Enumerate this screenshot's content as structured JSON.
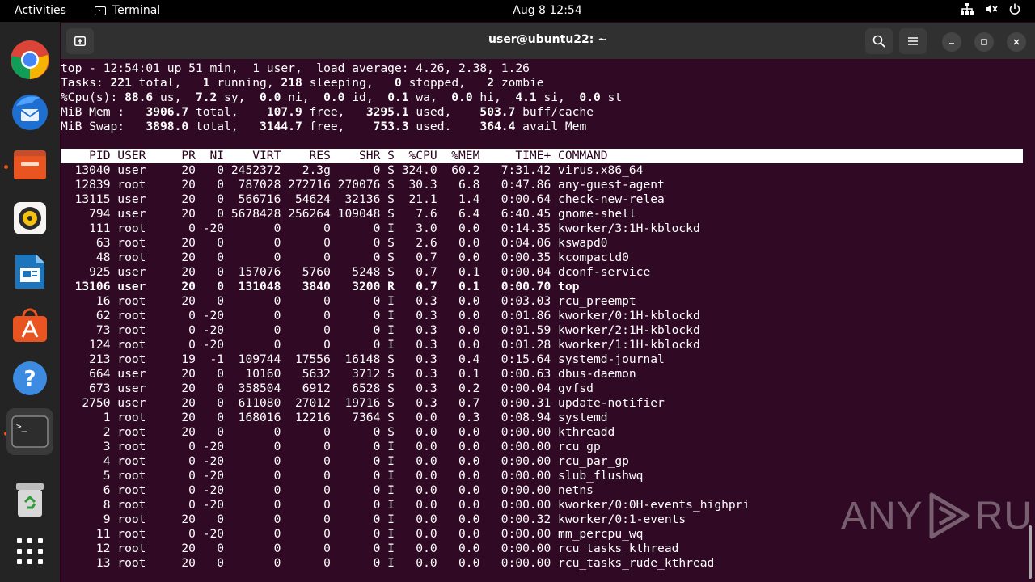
{
  "topbar": {
    "activities": "Activities",
    "app_name": "Terminal",
    "clock": "Aug 8  12:54"
  },
  "dock": {
    "items": [
      "Google Chrome",
      "Thunderbird Mail",
      "Files",
      "Rhythmbox",
      "LibreOffice Writer",
      "Ubuntu Software",
      "Help",
      "Terminal",
      "Trash",
      "Show Applications"
    ]
  },
  "window": {
    "title": "user@ubuntu22: ~"
  },
  "top": {
    "summary": {
      "line1": "top - 12:54:01 up 51 min,  1 user,  load average: 4.26, 2.38, 1.26",
      "tasks": [
        "Tasks: ",
        "221",
        " total,   ",
        "1",
        " running, ",
        "218",
        " sleeping,   ",
        "0",
        " stopped,   ",
        "2",
        " zombie"
      ],
      "cpu": [
        "%Cpu(s): ",
        "88.6",
        " us,  ",
        "7.2",
        " sy,  ",
        "0.0",
        " ni,  ",
        "0.0",
        " id,  ",
        "0.1",
        " wa,  ",
        "0.0",
        " hi,  ",
        "4.1",
        " si,  ",
        "0.0",
        " st"
      ],
      "mem": [
        "MiB Mem :   ",
        "3906.7",
        " total,    ",
        "107.9",
        " free,   ",
        "3295.1",
        " used,    ",
        "503.7",
        " buff/cache"
      ],
      "swap": [
        "MiB Swap:   ",
        "3898.0",
        " total,   ",
        "3144.7",
        " free,    ",
        "753.3",
        " used.    ",
        "364.4",
        " avail Mem"
      ]
    },
    "columns": [
      "PID",
      "USER",
      "PR",
      "NI",
      "VIRT",
      "RES",
      "SHR",
      "S",
      "%CPU",
      "%MEM",
      "TIME+",
      "COMMAND"
    ],
    "processes": [
      [
        "13040",
        "user",
        "20",
        "0",
        "2452372",
        "2.3g",
        "0",
        "S",
        "324.0",
        "60.2",
        "7:31.42",
        "virus.x86_64"
      ],
      [
        "12839",
        "root",
        "20",
        "0",
        "787028",
        "272716",
        "270076",
        "S",
        "30.3",
        "6.8",
        "0:47.86",
        "any-guest-agent"
      ],
      [
        "13115",
        "user",
        "20",
        "0",
        "566716",
        "54624",
        "32136",
        "S",
        "21.1",
        "1.4",
        "0:00.64",
        "check-new-relea"
      ],
      [
        "794",
        "user",
        "20",
        "0",
        "5678428",
        "256264",
        "109048",
        "S",
        "7.6",
        "6.4",
        "6:40.45",
        "gnome-shell"
      ],
      [
        "111",
        "root",
        "0",
        "-20",
        "0",
        "0",
        "0",
        "I",
        "3.0",
        "0.0",
        "0:14.35",
        "kworker/3:1H-kblockd"
      ],
      [
        "63",
        "root",
        "20",
        "0",
        "0",
        "0",
        "0",
        "S",
        "2.6",
        "0.0",
        "0:04.06",
        "kswapd0"
      ],
      [
        "48",
        "root",
        "20",
        "0",
        "0",
        "0",
        "0",
        "S",
        "0.7",
        "0.0",
        "0:00.35",
        "kcompactd0"
      ],
      [
        "925",
        "user",
        "20",
        "0",
        "157076",
        "5760",
        "5248",
        "S",
        "0.7",
        "0.1",
        "0:00.04",
        "dconf-service"
      ],
      [
        "13106",
        "user",
        "20",
        "0",
        "131048",
        "3840",
        "3200",
        "R",
        "0.7",
        "0.1",
        "0:00.70",
        "top"
      ],
      [
        "16",
        "root",
        "20",
        "0",
        "0",
        "0",
        "0",
        "I",
        "0.3",
        "0.0",
        "0:03.03",
        "rcu_preempt"
      ],
      [
        "62",
        "root",
        "0",
        "-20",
        "0",
        "0",
        "0",
        "I",
        "0.3",
        "0.0",
        "0:01.86",
        "kworker/0:1H-kblockd"
      ],
      [
        "73",
        "root",
        "0",
        "-20",
        "0",
        "0",
        "0",
        "I",
        "0.3",
        "0.0",
        "0:01.59",
        "kworker/2:1H-kblockd"
      ],
      [
        "124",
        "root",
        "0",
        "-20",
        "0",
        "0",
        "0",
        "I",
        "0.3",
        "0.0",
        "0:01.28",
        "kworker/1:1H-kblockd"
      ],
      [
        "213",
        "root",
        "19",
        "-1",
        "109744",
        "17556",
        "16148",
        "S",
        "0.3",
        "0.4",
        "0:15.64",
        "systemd-journal"
      ],
      [
        "664",
        "user",
        "20",
        "0",
        "10160",
        "5632",
        "3712",
        "S",
        "0.3",
        "0.1",
        "0:00.63",
        "dbus-daemon"
      ],
      [
        "673",
        "user",
        "20",
        "0",
        "358504",
        "6912",
        "6528",
        "S",
        "0.3",
        "0.2",
        "0:00.04",
        "gvfsd"
      ],
      [
        "2750",
        "user",
        "20",
        "0",
        "611080",
        "27012",
        "19716",
        "S",
        "0.3",
        "0.7",
        "0:00.31",
        "update-notifier"
      ],
      [
        "1",
        "root",
        "20",
        "0",
        "168016",
        "12216",
        "7364",
        "S",
        "0.0",
        "0.3",
        "0:08.94",
        "systemd"
      ],
      [
        "2",
        "root",
        "20",
        "0",
        "0",
        "0",
        "0",
        "S",
        "0.0",
        "0.0",
        "0:00.00",
        "kthreadd"
      ],
      [
        "3",
        "root",
        "0",
        "-20",
        "0",
        "0",
        "0",
        "I",
        "0.0",
        "0.0",
        "0:00.00",
        "rcu_gp"
      ],
      [
        "4",
        "root",
        "0",
        "-20",
        "0",
        "0",
        "0",
        "I",
        "0.0",
        "0.0",
        "0:00.00",
        "rcu_par_gp"
      ],
      [
        "5",
        "root",
        "0",
        "-20",
        "0",
        "0",
        "0",
        "I",
        "0.0",
        "0.0",
        "0:00.00",
        "slub_flushwq"
      ],
      [
        "6",
        "root",
        "0",
        "-20",
        "0",
        "0",
        "0",
        "I",
        "0.0",
        "0.0",
        "0:00.00",
        "netns"
      ],
      [
        "8",
        "root",
        "0",
        "-20",
        "0",
        "0",
        "0",
        "I",
        "0.0",
        "0.0",
        "0:00.00",
        "kworker/0:0H-events_highpri"
      ],
      [
        "9",
        "root",
        "20",
        "0",
        "0",
        "0",
        "0",
        "I",
        "0.0",
        "0.0",
        "0:00.32",
        "kworker/0:1-events"
      ],
      [
        "11",
        "root",
        "0",
        "-20",
        "0",
        "0",
        "0",
        "I",
        "0.0",
        "0.0",
        "0:00.00",
        "mm_percpu_wq"
      ],
      [
        "12",
        "root",
        "20",
        "0",
        "0",
        "0",
        "0",
        "I",
        "0.0",
        "0.0",
        "0:00.00",
        "rcu_tasks_kthread"
      ],
      [
        "13",
        "root",
        "20",
        "0",
        "0",
        "0",
        "0",
        "I",
        "0.0",
        "0.0",
        "0:00.00",
        "rcu_tasks_rude_kthread"
      ]
    ],
    "highlighted_pid": "13106"
  },
  "watermark": {
    "left": "ANY",
    "right": "RUN"
  },
  "colors": {
    "terminal_bg": "#300a24",
    "dock_bg": "#242424",
    "accent": "#e95420"
  }
}
